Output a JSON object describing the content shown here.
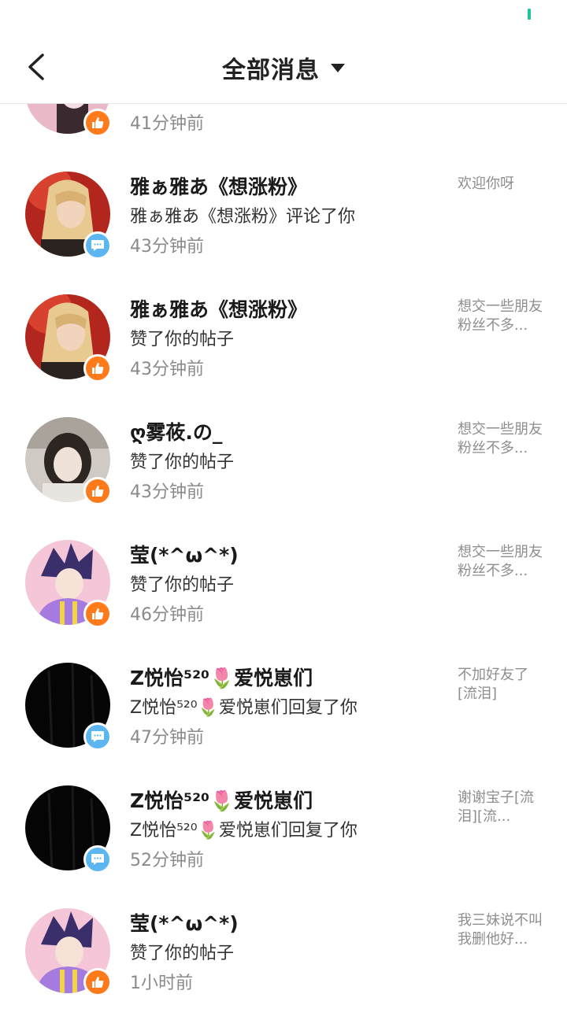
{
  "header": {
    "title": "全部消息"
  },
  "messages": [
    {
      "name": "",
      "action": "",
      "time": "41分钟前",
      "preview": "",
      "badge": "like"
    },
    {
      "name": "雅ぁ雅あ《想涨粉》",
      "action": "雅ぁ雅あ《想涨粉》评论了你",
      "time": "43分钟前",
      "preview": "欢迎你呀",
      "badge": "comment"
    },
    {
      "name": "雅ぁ雅あ《想涨粉》",
      "action": "赞了你的帖子",
      "time": "43分钟前",
      "preview": "想交一些朋友粉丝不多...",
      "badge": "like"
    },
    {
      "name": "ღ雾莜.の_",
      "action": "赞了你的帖子",
      "time": "43分钟前",
      "preview": "想交一些朋友粉丝不多...",
      "badge": "like"
    },
    {
      "name": "莹(*^ω^*)",
      "action": "赞了你的帖子",
      "time": "46分钟前",
      "preview": "想交一些朋友粉丝不多...",
      "badge": "like"
    },
    {
      "name": "Z悦怡⁵²⁰🌷爱悦崽们",
      "action": "Z悦怡⁵²⁰🌷爱悦崽们回复了你",
      "time": "47分钟前",
      "preview": "不加好友了[流泪]",
      "badge": "comment"
    },
    {
      "name": "Z悦怡⁵²⁰🌷爱悦崽们",
      "action": "Z悦怡⁵²⁰🌷爱悦崽们回复了你",
      "time": "52分钟前",
      "preview": "谢谢宝子[流泪][流...",
      "badge": "comment"
    },
    {
      "name": "莹(*^ω^*)",
      "action": "赞了你的帖子",
      "time": "1小时前",
      "preview": "我三妹说不叫我删他好...",
      "badge": "like"
    }
  ],
  "colors": {
    "like_badge": "#ff7a1a",
    "comment_badge": "#5cb6f2",
    "status_accent": "#21c4a0"
  }
}
